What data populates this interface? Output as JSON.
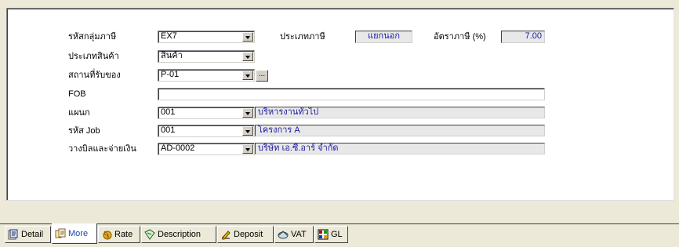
{
  "form": {
    "tax_group": {
      "label": "รหัสกลุ่มภาษี",
      "value": "EX7"
    },
    "tax_type": {
      "label": "ประเภทภาษี",
      "value": "แยกนอก"
    },
    "tax_rate": {
      "label": "อัตราภาษี (%)",
      "value": "7.00"
    },
    "product_type": {
      "label": "ประเภทสินค้า",
      "value": "สินค้า"
    },
    "receive_place": {
      "label": "สถานที่รับของ",
      "value": "P-01",
      "browse": "..."
    },
    "fob": {
      "label": "FOB",
      "value": ""
    },
    "department": {
      "label": "แผนก",
      "value": "001",
      "desc": "บริหารงานทั่วไป"
    },
    "job_code": {
      "label": "รหัส Job",
      "value": "001",
      "desc": "โครงการ A"
    },
    "billing": {
      "label": "วางบิลและจ่ายเงิน",
      "value": "AD-0002",
      "desc": "บริษัท เอ.ซี.อาร์ จำกัด"
    }
  },
  "tabs": [
    {
      "label": "Detail",
      "icon": "detail-icon"
    },
    {
      "label": "More",
      "icon": "more-icon",
      "active": true
    },
    {
      "label": "Rate",
      "icon": "rate-icon"
    },
    {
      "label": "Description",
      "icon": "description-icon"
    },
    {
      "label": "Deposit",
      "icon": "deposit-icon"
    },
    {
      "label": "VAT",
      "icon": "vat-icon"
    },
    {
      "label": "GL",
      "icon": "gl-icon"
    }
  ]
}
